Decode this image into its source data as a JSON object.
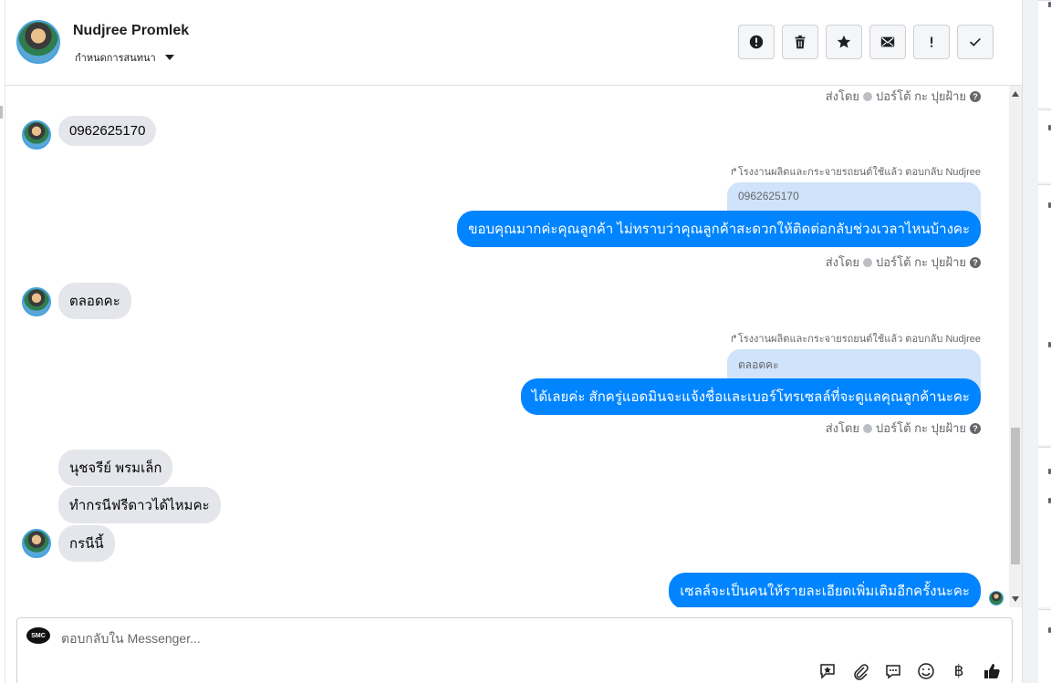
{
  "header": {
    "contact_name": "Nudjree Promlek",
    "conversation_settings": "กำหนดการสนทนา"
  },
  "toolbar": {
    "buttons": [
      {
        "name": "spam",
        "icon": "alert-circle-icon"
      },
      {
        "name": "delete",
        "icon": "trash-icon"
      },
      {
        "name": "star",
        "icon": "star-icon"
      },
      {
        "name": "mark-unread",
        "icon": "envelope-icon"
      },
      {
        "name": "important",
        "icon": "exclamation-icon"
      },
      {
        "name": "done",
        "icon": "check-icon"
      }
    ]
  },
  "messages": {
    "sent_by_1": {
      "prefix": "ส่งโดย",
      "name": "ปอร์โต้ กะ ปุยฝ้าย"
    },
    "incoming_1": "0962625170",
    "reply_label_1": "โรงงานผลิตและกระจายรถยนต์ใช้แล้ว ตอบกลับ Nudjree",
    "quote_1": "0962625170",
    "outgoing_1": "ขอบคุณมากค่ะคุณลูกค้า ไม่ทราบว่าคุณลูกค้าสะดวกให้ติดต่อกลับช่วงเวลาไหนบ้างคะ",
    "sent_by_2": {
      "prefix": "ส่งโดย",
      "name": "ปอร์โต้ กะ ปุยฝ้าย"
    },
    "incoming_2": "ตลอดคะ",
    "reply_label_2": "โรงงานผลิตและกระจายรถยนต์ใช้แล้ว ตอบกลับ Nudjree",
    "quote_2": "ตลอดคะ",
    "outgoing_2": "ได้เลยค่ะ สักครู่แอดมินจะแจ้งชื่อและเบอร์โทรเซลล์ที่จะดูแลคุณลูกค้านะคะ",
    "sent_by_3": {
      "prefix": "ส่งโดย",
      "name": "ปอร์โต้ กะ ปุยฝ้าย"
    },
    "incoming_3": "นุชจรีย์ พรมเล็ก",
    "incoming_4": "ทำกรนีฟรีดาวได้ไหมคะ",
    "incoming_5": "กรนีนี้",
    "outgoing_3": "เซลล์จะเป็นคนให้รายละเอียดเพิ่มเติมอีกครั้งนะคะ"
  },
  "composer": {
    "placeholder": "ตอบกลับใน Messenger...",
    "page_avatar_text": "SMC",
    "tools": [
      "saved-reply-icon",
      "paperclip-icon",
      "chat-bubble-icon",
      "emoji-icon",
      "baht-icon",
      "thumbs-up-icon"
    ]
  },
  "colors": {
    "outgoing_bubble": "#0084ff",
    "incoming_bubble": "#e4e6eb",
    "quote_bubble": "#cfe3fb"
  }
}
